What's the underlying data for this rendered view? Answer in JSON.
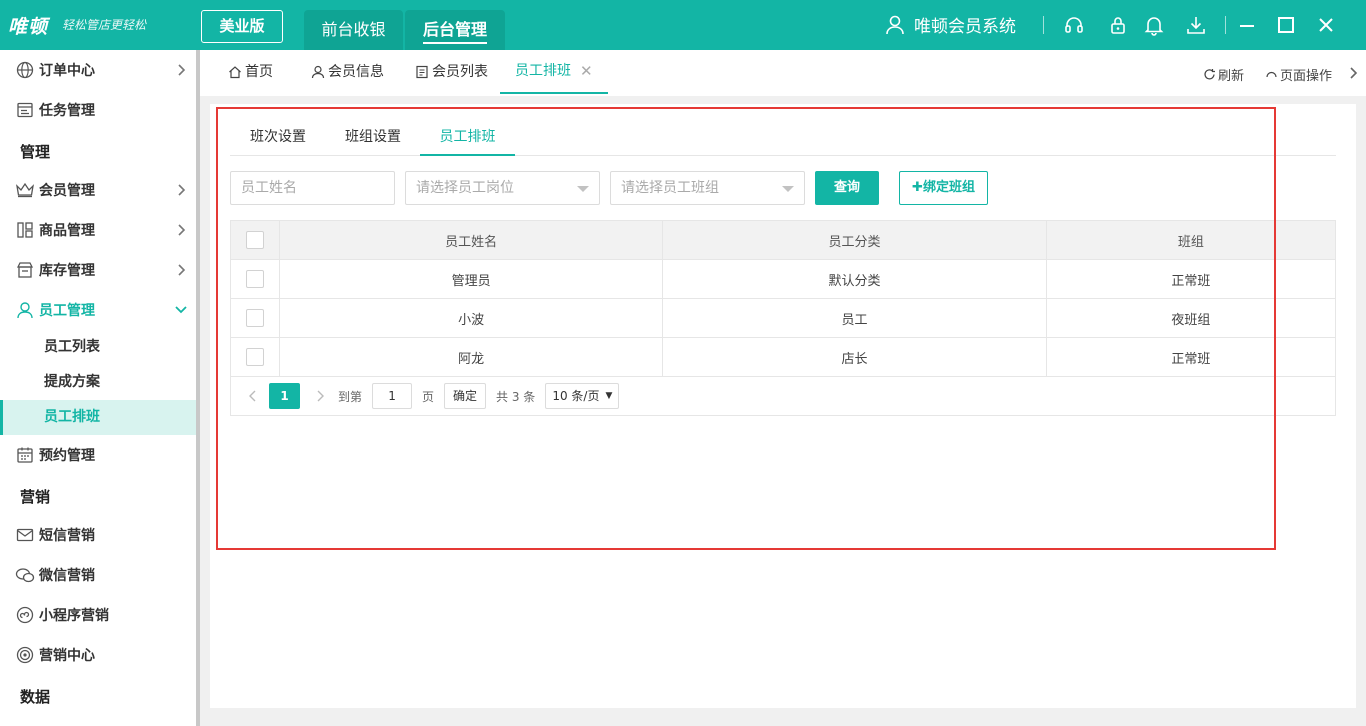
{
  "header": {
    "logo": "唯顿",
    "slogan": "轻松管店更轻松",
    "edition": "美业版",
    "tabs": [
      {
        "label": "前台收银"
      },
      {
        "label": "后台管理"
      }
    ],
    "system_name": "唯顿会员系统"
  },
  "sidebar": {
    "items": [
      {
        "label": "订单中心",
        "icon": "globe-icon"
      },
      {
        "label": "任务管理",
        "icon": "task-icon"
      },
      {
        "group": "管理"
      },
      {
        "label": "会员管理",
        "icon": "crown-icon"
      },
      {
        "label": "商品管理",
        "icon": "goods-icon"
      },
      {
        "label": "库存管理",
        "icon": "store-icon"
      },
      {
        "label": "员工管理",
        "icon": "person-icon",
        "open": true
      },
      {
        "label": "预约管理",
        "icon": "calendar-icon"
      },
      {
        "group": "营销"
      },
      {
        "label": "短信营销",
        "icon": "mail-icon"
      },
      {
        "label": "微信营销",
        "icon": "wechat-icon"
      },
      {
        "label": "小程序营销",
        "icon": "miniapp-icon"
      },
      {
        "label": "营销中心",
        "icon": "target-icon"
      },
      {
        "group": "数据"
      }
    ],
    "staff_sub": [
      {
        "label": "员工列表"
      },
      {
        "label": "提成方案"
      },
      {
        "label": "员工排班",
        "active": true
      }
    ]
  },
  "page_tabs": [
    {
      "label": "首页",
      "icon": "home-icon"
    },
    {
      "label": "会员信息",
      "icon": "user-icon"
    },
    {
      "label": "会员列表",
      "icon": "list-icon"
    },
    {
      "label": "员工排班",
      "active": true,
      "closable": true
    }
  ],
  "page_tools": {
    "refresh": "刷新",
    "page_ops": "页面操作"
  },
  "sub_tabs": [
    {
      "label": "班次设置"
    },
    {
      "label": "班组设置"
    },
    {
      "label": "员工排班",
      "active": true
    }
  ],
  "filters": {
    "name_placeholder": "员工姓名",
    "position_placeholder": "请选择员工岗位",
    "group_placeholder": "请选择员工班组",
    "query_label": "查询",
    "bind_label": "✚绑定班组"
  },
  "table": {
    "columns": [
      "员工姓名",
      "员工分类",
      "班组"
    ],
    "rows": [
      {
        "name": "管理员",
        "category": "默认分类",
        "group": "正常班"
      },
      {
        "name": "小波",
        "category": "员工",
        "group": "夜班组"
      },
      {
        "name": "阿龙",
        "category": "店长",
        "group": "正常班"
      }
    ]
  },
  "pager": {
    "current": "1",
    "goto_prefix": "到第",
    "goto_value": "1",
    "goto_suffix": "页",
    "confirm": "确定",
    "total": "共 3 条",
    "page_size": "10 条/页"
  },
  "colors": {
    "accent": "#13b5a5",
    "highlight_box": "#e53935"
  }
}
